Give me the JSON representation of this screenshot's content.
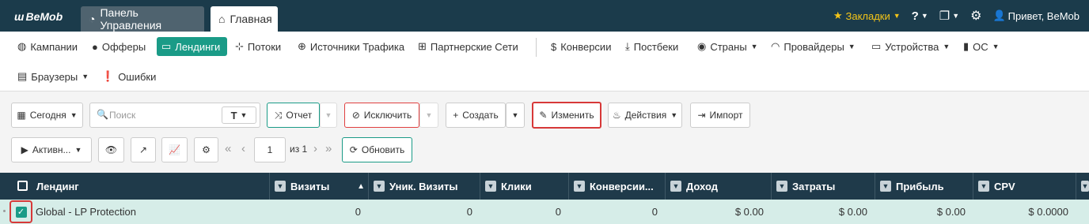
{
  "app": {
    "logo": "BeMob",
    "tabs": [
      {
        "label": "Панель Управления"
      },
      {
        "label": "Главная"
      }
    ],
    "bookmarks_label": "Закладки",
    "greeting": "Привет, BeMob"
  },
  "nav": {
    "items": [
      {
        "label": "Кампании"
      },
      {
        "label": "Офферы"
      },
      {
        "label": "Лендинги"
      },
      {
        "label": "Потоки"
      },
      {
        "label": "Источники Трафика"
      },
      {
        "label": "Партнерские Сети"
      },
      {
        "label": "Конверсии"
      },
      {
        "label": "Постбеки"
      },
      {
        "label": "Страны"
      },
      {
        "label": "Провайдеры"
      },
      {
        "label": "Устройства"
      },
      {
        "label": "ОС"
      },
      {
        "label": "Браузеры"
      },
      {
        "label": "Ошибки"
      }
    ]
  },
  "toolbar": {
    "date_label": "Сегодня",
    "search_placeholder": "Поиск",
    "search_type": "T",
    "report_label": "Отчет",
    "exclude_label": "Исключить",
    "create_label": "Создать",
    "edit_label": "Изменить",
    "actions_label": "Действия",
    "import_label": "Импорт",
    "status_label": "Активн...",
    "page_value": "1",
    "page_of": "из 1",
    "refresh_label": "Обновить"
  },
  "table": {
    "columns": [
      {
        "label": "Лендинг"
      },
      {
        "label": "Визиты"
      },
      {
        "label": "Уник. Визиты"
      },
      {
        "label": "Клики"
      },
      {
        "label": "Конверсии..."
      },
      {
        "label": "Доход"
      },
      {
        "label": "Затраты"
      },
      {
        "label": "Прибыль"
      },
      {
        "label": "CPV"
      }
    ],
    "rows": [
      {
        "name": "Global - LP Protection",
        "visits": "0",
        "unique_visits": "0",
        "clicks": "0",
        "conversions": "0",
        "revenue": "$ 0.00",
        "cost": "$ 0.00",
        "profit": "$ 0.00",
        "cpv": "$ 0.0000"
      }
    ]
  },
  "colors": {
    "topbar": "#1b3b4b",
    "accent": "#1a9b87",
    "highlight": "#d73838",
    "row_selected": "#d6ede8"
  }
}
